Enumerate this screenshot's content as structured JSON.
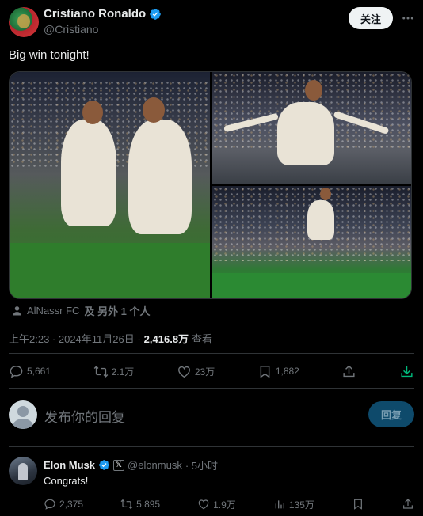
{
  "tweet": {
    "author": {
      "display_name": "Cristiano Ronaldo",
      "handle": "@Cristiano",
      "verified": true
    },
    "follow_label": "关注",
    "more_icon": "more-horizontal-icon",
    "text": "Big win tonight!",
    "media_count": 3,
    "tagged": {
      "account": "AlNassr FC",
      "and_label": "及 另外 1 个人"
    },
    "timestamp": "上午2:23 · 2024年11月26日 · ",
    "views": "2,416.8万",
    "views_label": "查看",
    "stats": {
      "replies": "5,661",
      "reposts": "2.1万",
      "likes": "23万",
      "bookmarks": "1,882"
    }
  },
  "reply_box": {
    "placeholder": "发布你的回复",
    "button_label": "回复"
  },
  "comment": {
    "author": {
      "display_name": "Elon Musk",
      "handle": "@elonmusk",
      "verified": true,
      "affiliate_badge": "𝕏"
    },
    "time": "· 5小时",
    "text": "Congrats!",
    "stats": {
      "replies": "2,375",
      "reposts": "5,895",
      "likes": "1.9万",
      "views": "135万"
    }
  },
  "colors": {
    "background": "#000000",
    "text": "#e7e9ea",
    "muted": "#71767b",
    "accent": "#1d9bf0",
    "divider": "#2f3336",
    "share_accent": "#00ba7c"
  }
}
